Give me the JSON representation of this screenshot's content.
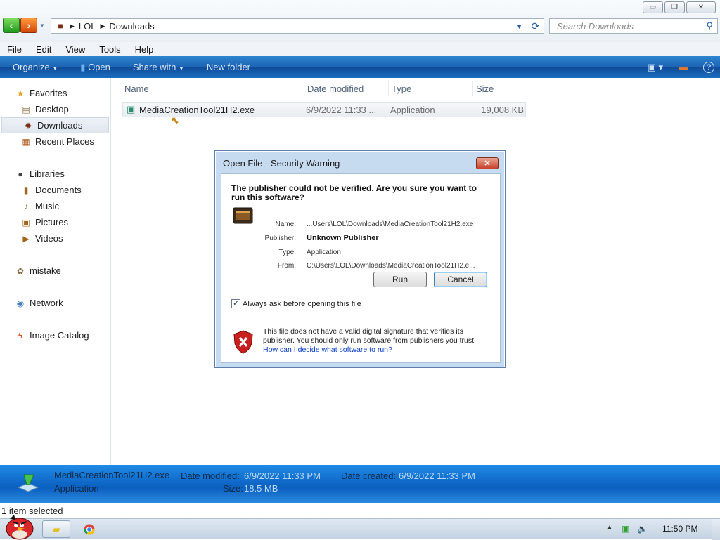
{
  "window": {
    "minimize_glyph": "▭",
    "maximize_glyph": "❐",
    "close_glyph": "✕"
  },
  "address": {
    "crumbs": [
      "LOL",
      "Downloads"
    ],
    "search_placeholder": "Search Downloads"
  },
  "menubar": [
    "File",
    "Edit",
    "View",
    "Tools",
    "Help"
  ],
  "toolbar": {
    "organize": "Organize",
    "open": "Open",
    "share_with": "Share with",
    "new_folder": "New folder"
  },
  "sidebar": {
    "favorites": "Favorites",
    "desktop": "Desktop",
    "downloads": "Downloads",
    "recent_places": "Recent Places",
    "libraries": "Libraries",
    "documents": "Documents",
    "music": "Music",
    "pictures": "Pictures",
    "videos": "Videos",
    "mistake": "mistake",
    "network": "Network",
    "image_catalog": "Image Catalog"
  },
  "columns": {
    "name": "Name",
    "date_modified": "Date modified",
    "type": "Type",
    "size": "Size"
  },
  "file": {
    "name": "MediaCreationTool21H2.exe",
    "date_modified": "6/9/2022 11:33 ...",
    "type": "Application",
    "size": "19,008 KB"
  },
  "dialog": {
    "title": "Open File - Security Warning",
    "question": "The publisher could not be verified.  Are you sure you want to run this software?",
    "name_label": "Name:",
    "name_value": "...Users\\LOL\\Downloads\\MediaCreationTool21H2.exe",
    "publisher_label": "Publisher:",
    "publisher_value": "Unknown Publisher",
    "type_label": "Type:",
    "type_value": "Application",
    "from_label": "From:",
    "from_value": "C:\\Users\\LOL\\Downloads\\MediaCreationTool21H2.e...",
    "run_button": "Run",
    "cancel_button": "Cancel",
    "always_ask_label": "Always ask before opening this file",
    "always_ask_checked": true,
    "warning_text": "This file does not have a valid digital signature that verifies its publisher.  You should only run software from publishers you trust.",
    "warning_link": "How can I decide what software to run?"
  },
  "details": {
    "filename": "MediaCreationTool21H2.exe",
    "kind": "Application",
    "date_modified_label": "Date modified:",
    "date_modified_value": "6/9/2022 11:33 PM",
    "size_label": "Size:",
    "size_value": "18.5 MB",
    "date_created_label": "Date created:",
    "date_created_value": "6/9/2022 11:33 PM"
  },
  "status": {
    "selection": "1 item selected"
  },
  "taskbar": {
    "clock": "11:50 PM"
  }
}
